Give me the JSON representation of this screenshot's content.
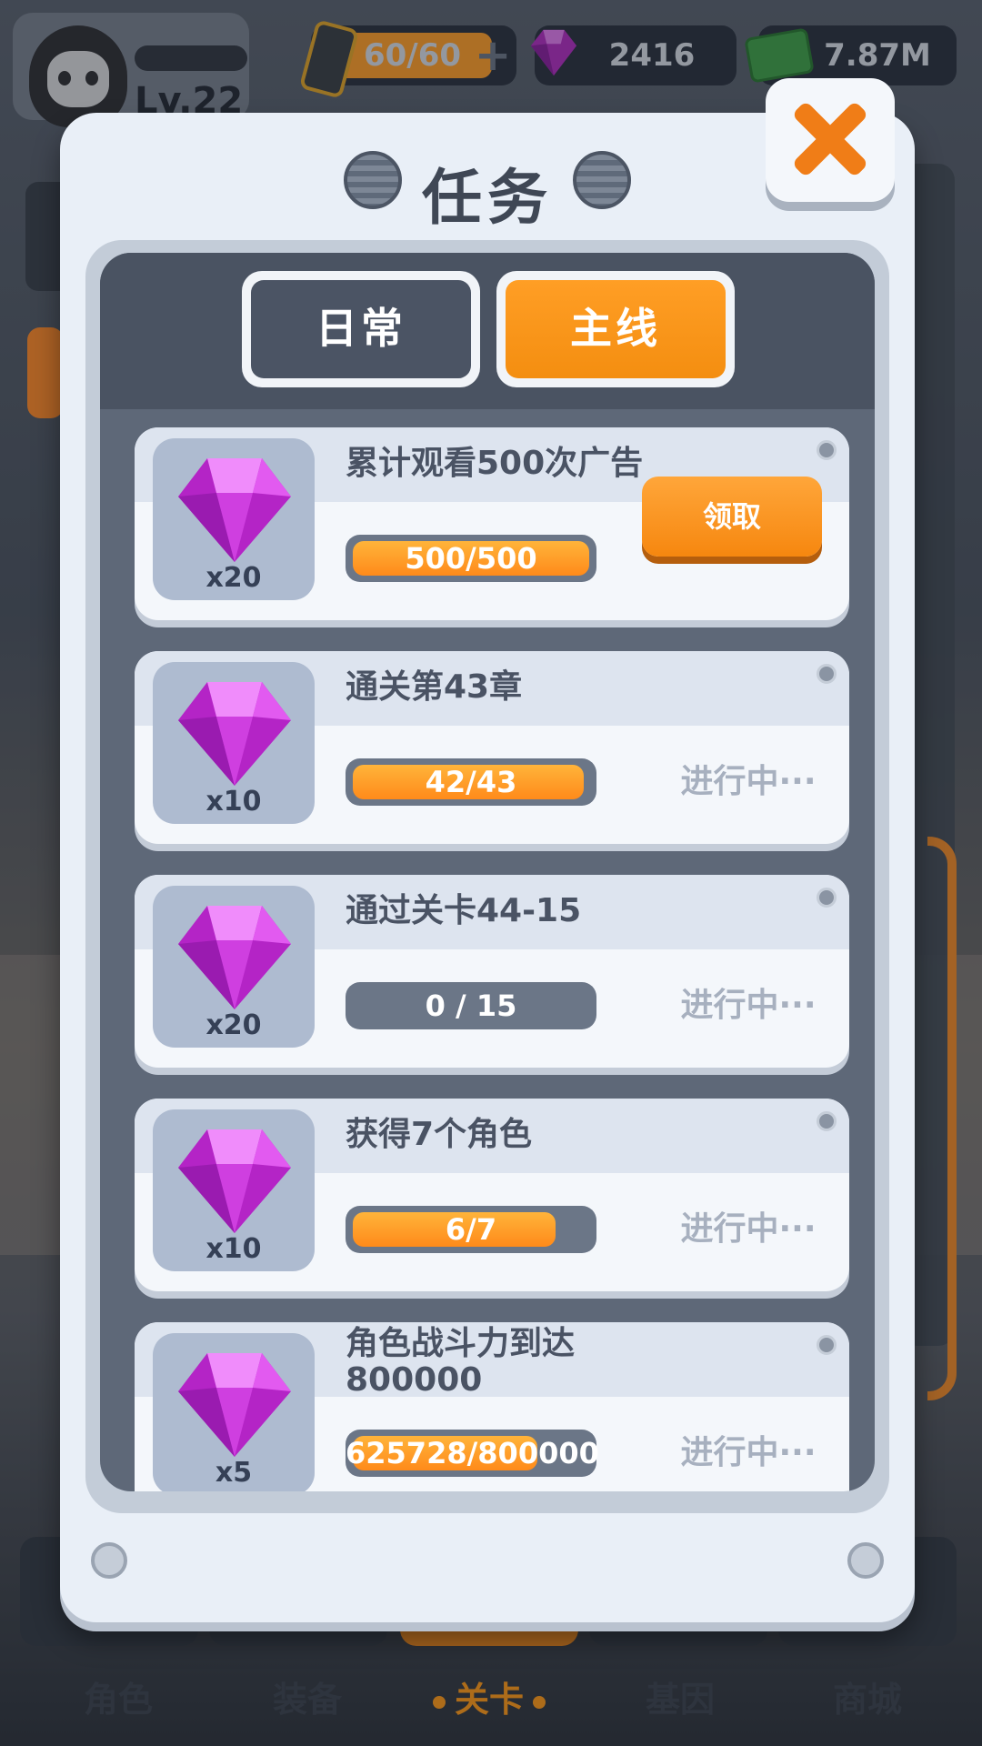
{
  "topbar": {
    "level": "Lv.22",
    "energy": "60/60",
    "gems": "2416",
    "cash": "7.87M",
    "energy_fill": 1.0
  },
  "dialog": {
    "title": "任务",
    "tabs": [
      {
        "label": "日常",
        "active": false
      },
      {
        "label": "主线",
        "active": true
      }
    ],
    "tasks": [
      {
        "title": "累计观看500次广告",
        "reward_qty": "x20",
        "progress_text": "500/500",
        "progress": 1.0,
        "action": "领取",
        "status": ""
      },
      {
        "title": "通关第43章",
        "reward_qty": "x10",
        "progress_text": "42/43",
        "progress": 0.977,
        "action": "",
        "status": "进行中···"
      },
      {
        "title": "通过关卡44-15",
        "reward_qty": "x20",
        "progress_text": "0 / 15",
        "progress": 0.0,
        "action": "",
        "status": "进行中···"
      },
      {
        "title": "获得7个角色",
        "reward_qty": "x10",
        "progress_text": "6/7",
        "progress": 0.857,
        "action": "",
        "status": "进行中···"
      },
      {
        "title": "角色战斗力到达800000",
        "reward_qty": "x5",
        "progress_text": "625728/800000",
        "progress": 0.782,
        "action": "",
        "status": "进行中···"
      }
    ]
  },
  "nav": {
    "items": [
      {
        "label": "角色",
        "active": false
      },
      {
        "label": "装备",
        "active": false
      },
      {
        "label": "关卡",
        "active": true
      },
      {
        "label": "基因",
        "active": false
      },
      {
        "label": "商城",
        "active": false
      }
    ]
  },
  "colors": {
    "accent": "#f48e10",
    "panel": "#e9eff7",
    "inner": "#5e6878",
    "gem": "#d534e0"
  },
  "icons": {
    "close": "close-icon",
    "gem": "gem-icon",
    "energy": "battery-icon",
    "cash": "cash-icon"
  }
}
